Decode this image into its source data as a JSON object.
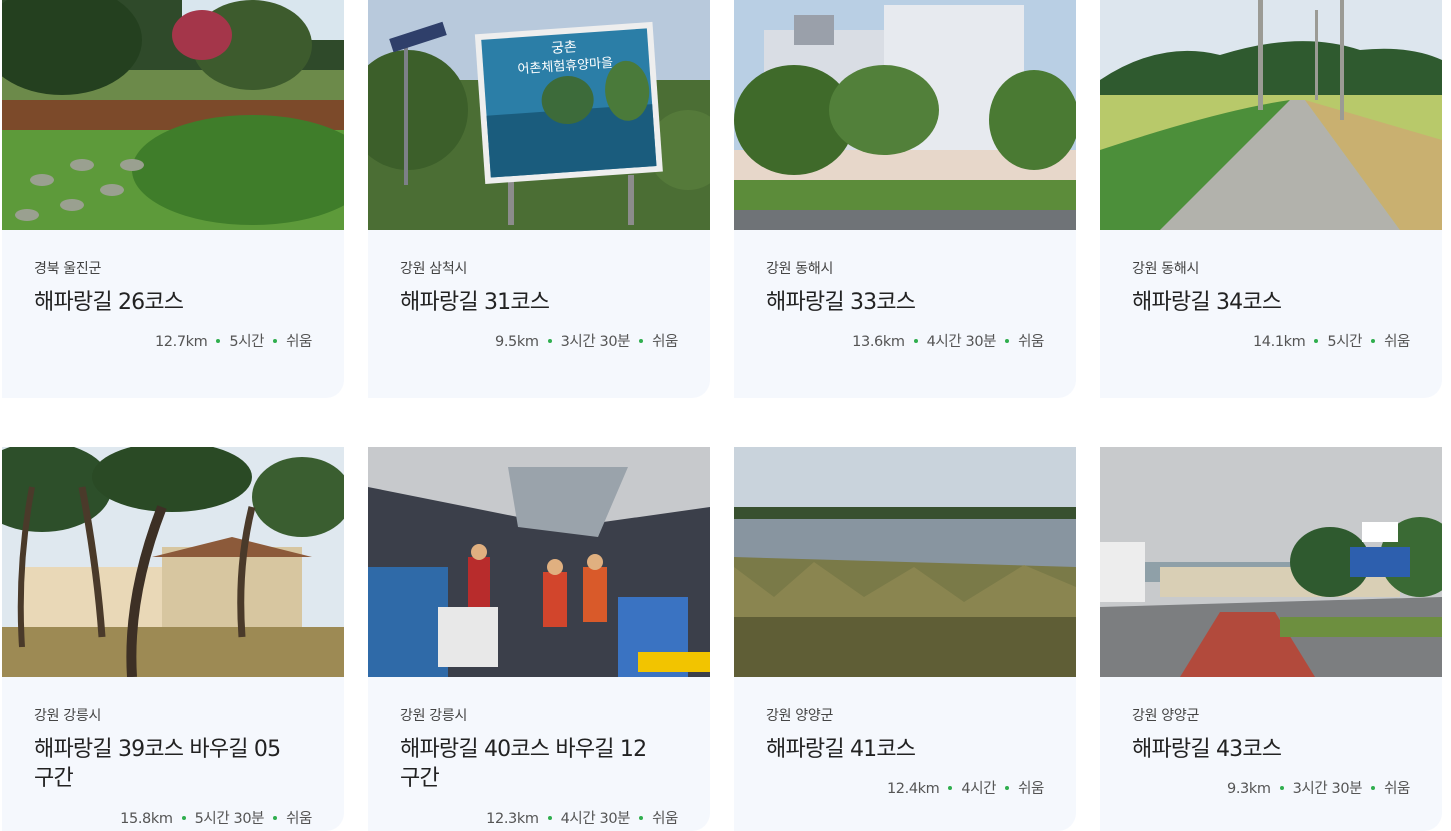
{
  "courses": [
    {
      "region": "경북 울진군",
      "title": "해파랑길 26코스",
      "distance": "12.7km",
      "duration": "5시간",
      "difficulty": "쉬움",
      "photo": "flower-garden-with-stepping-stones"
    },
    {
      "region": "강원 삼척시",
      "title": "해파랑길 31코스",
      "distance": "9.5km",
      "duration": "3시간 30분",
      "difficulty": "쉬움",
      "photo": "village-billboard",
      "sign_text": "어촌체험휴양마을",
      "sign_top": "궁촌"
    },
    {
      "region": "강원 동해시",
      "title": "해파랑길 33코스",
      "distance": "13.6km",
      "duration": "4시간 30분",
      "difficulty": "쉬움",
      "photo": "industrial-building"
    },
    {
      "region": "강원 동해시",
      "title": "해파랑길 34코스",
      "distance": "14.1km",
      "duration": "5시간",
      "difficulty": "쉬움",
      "photo": "rural-road-rice-field"
    },
    {
      "region": "강원 강릉시",
      "title": "해파랑길 39코스 바우길 05구간",
      "distance": "15.8km",
      "duration": "5시간 30분",
      "difficulty": "쉬움",
      "photo": "pine-grove-with-building"
    },
    {
      "region": "강원 강릉시",
      "title": "해파랑길 40코스 바우길 12구간",
      "distance": "12.3km",
      "duration": "4시간 30분",
      "difficulty": "쉬움",
      "photo": "fish-market-hikers"
    },
    {
      "region": "강원 양양군",
      "title": "해파랑길 41코스",
      "distance": "12.4km",
      "duration": "4시간",
      "difficulty": "쉬움",
      "photo": "lake-with-reeds"
    },
    {
      "region": "강원 양양군",
      "title": "해파랑길 43코스",
      "distance": "9.3km",
      "duration": "3시간 30분",
      "difficulty": "쉬움",
      "photo": "beach-entrance-sign"
    }
  ],
  "colors": {
    "card_bg": "#f5f8fd",
    "dot": "#2fae4e",
    "title": "#222222"
  }
}
